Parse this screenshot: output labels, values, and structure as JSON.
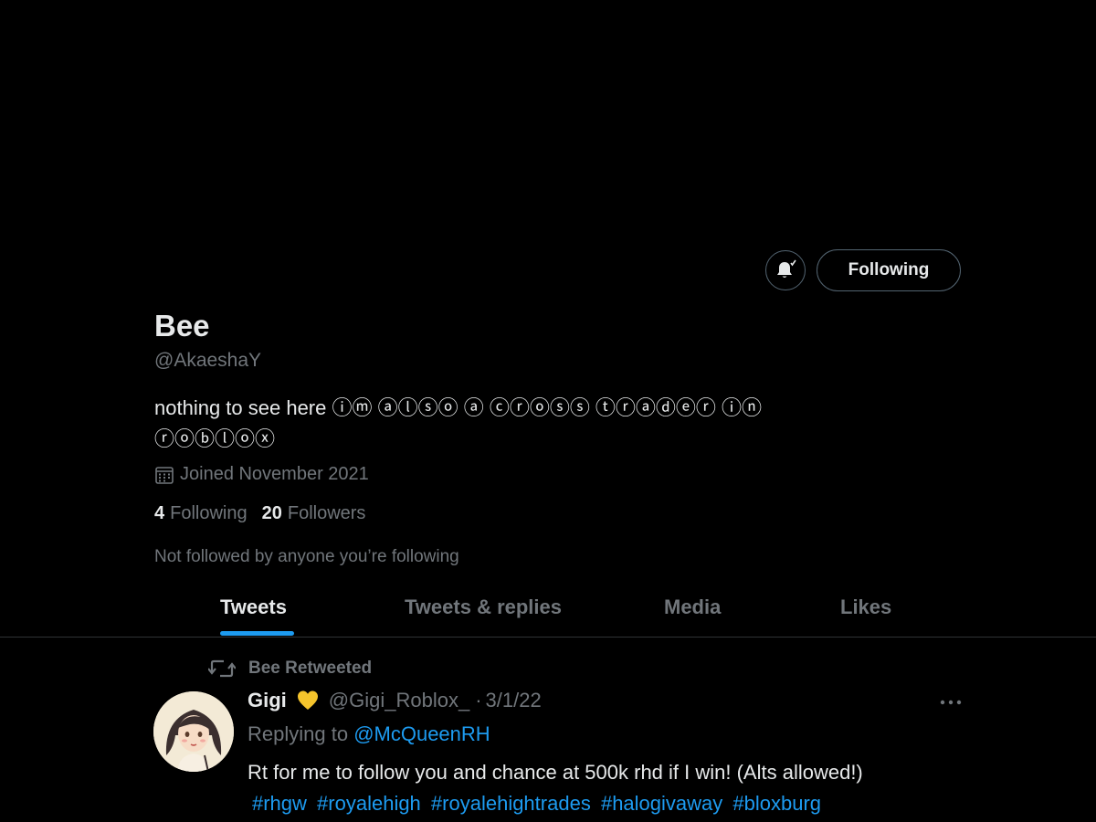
{
  "profile": {
    "name": "Bee",
    "handle": "@AkaeshaY",
    "bio_line1": "nothing to see here ⓘⓜ ⓐⓛⓢⓞ ⓐ ⓒⓡⓞⓢⓢ ⓣⓡⓐⓓⓔⓡ ⓘⓝ",
    "bio_line2": "ⓡⓞⓑⓛⓞⓧ",
    "joined": "Joined November 2021",
    "following_count": "4",
    "following_label": "Following",
    "followers_count": "20",
    "followers_label": "Followers",
    "not_followed": "Not followed by anyone you’re following"
  },
  "actions": {
    "notification_icon": "bell-check-icon",
    "follow_label": "Following"
  },
  "tabs": [
    {
      "label": "Tweets",
      "active": true
    },
    {
      "label": "Tweets & replies",
      "active": false
    },
    {
      "label": "Media",
      "active": false
    },
    {
      "label": "Likes",
      "active": false
    }
  ],
  "tweet": {
    "retweeted_by": "Bee Retweeted",
    "author_name": "Gigi",
    "author_emoji": "yellow-heart-icon",
    "author_handle": "@Gigi_Roblox_",
    "date": "3/1/22",
    "replying_prefix": "Replying to ",
    "replying_to": "@McQueenRH",
    "text": "Rt for me to follow you and chance at 500k rhd if I win! (Alts allowed!)",
    "hashtags": [
      "#rhgw",
      "#royalehigh",
      "#royalehightrades",
      "#halogivaway",
      "#bloxburg"
    ]
  },
  "colors": {
    "background": "#000000",
    "primary_text": "#e7e9ea",
    "secondary_text": "#71767b",
    "accent": "#1d9bf0",
    "border": "#536471"
  }
}
